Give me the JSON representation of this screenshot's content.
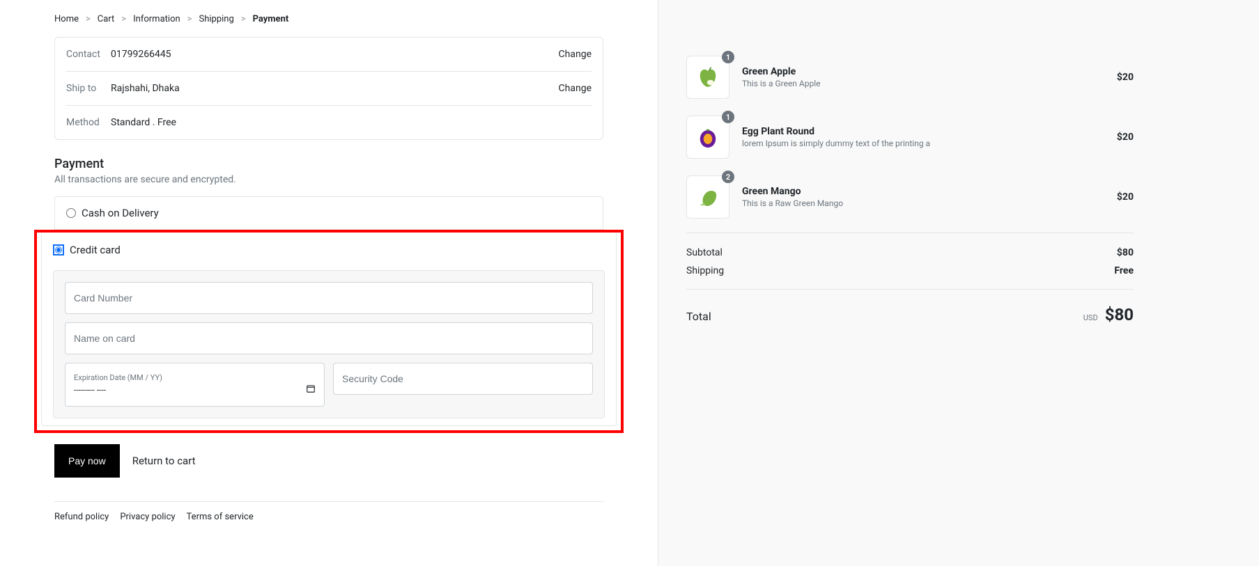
{
  "breadcrumbs": {
    "home": "Home",
    "cart": "Cart",
    "information": "Information",
    "shipping": "Shipping",
    "payment": "Payment"
  },
  "summary": {
    "contact_label": "Contact",
    "contact_value": "01799266445",
    "contact_change": "Change",
    "ship_label": "Ship to",
    "ship_value": "Rajshahi, Dhaka",
    "ship_change": "Change",
    "method_label": "Method",
    "method_value": "Standard . Free"
  },
  "payment": {
    "title": "Payment",
    "subtitle": "All transactions are secure and encrypted.",
    "cod_label": "Cash on Delivery",
    "cc_label": "Credit card",
    "card_number_placeholder": "Card Number",
    "name_on_card_placeholder": "Name on card",
    "exp_label": "Expiration Date (MM / YY)",
    "exp_value": "---------  ----",
    "security_code_placeholder": "Security Code"
  },
  "actions": {
    "pay_now": "Pay now",
    "return_to_cart": "Return to cart"
  },
  "footer": {
    "refund": "Refund policy",
    "privacy": "Privacy policy",
    "terms": "Terms of service"
  },
  "cart": {
    "items": [
      {
        "name": "Green Apple",
        "desc": "This is a Green Apple",
        "qty": "1",
        "price": "$20"
      },
      {
        "name": "Egg Plant Round",
        "desc": "lorem Ipsum is simply dummy text of the printing a",
        "qty": "1",
        "price": "$20"
      },
      {
        "name": "Green Mango",
        "desc": "This is a Raw Green Mango",
        "qty": "2",
        "price": "$20"
      }
    ],
    "subtotal_label": "Subtotal",
    "subtotal_value": "$80",
    "shipping_label": "Shipping",
    "shipping_value": "Free",
    "total_label": "Total",
    "total_currency": "USD",
    "total_value": "$80"
  }
}
